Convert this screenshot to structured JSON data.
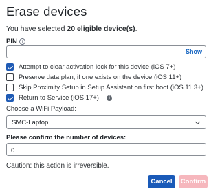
{
  "dialog": {
    "title": "Erase devices",
    "selected_prefix": "You have selected ",
    "selected_count": "20 eligible device(s)",
    "selected_suffix": "."
  },
  "pin": {
    "label": "PIN",
    "value": "",
    "placeholder": "",
    "show_label": "Show"
  },
  "options": [
    {
      "label": "Attempt to clear activation lock for this device (iOS 7+)",
      "checked": true
    },
    {
      "label": "Preserve data plan, if one exists on the device (iOS 11+)",
      "checked": false
    },
    {
      "label": "Skip Proximity Setup in Setup Assistant on first boot (iOS 11.3+)",
      "checked": false
    },
    {
      "label": "Return to Service (iOS 17+)",
      "checked": true
    }
  ],
  "wifi": {
    "label": "Choose a WiFi Payload:",
    "selected": "SMC-Laptop"
  },
  "confirm": {
    "label": "Please confirm the number of devices:",
    "value": "0"
  },
  "caution": "Caution: this action is irreversible.",
  "buttons": {
    "cancel": "Cancel",
    "confirm": "Confirm"
  },
  "colors": {
    "primary": "#1a5ab8",
    "confirm_disabled": "#f6b7bd",
    "link": "#1665c1",
    "checkbox_checked": "#1f5bb5"
  },
  "icons": {
    "pin_info": "info-outline-icon",
    "return_service_info": "info-filled-icon",
    "select_chevron": "chevron-down-icon",
    "checkbox_check": "checkmark-icon"
  }
}
